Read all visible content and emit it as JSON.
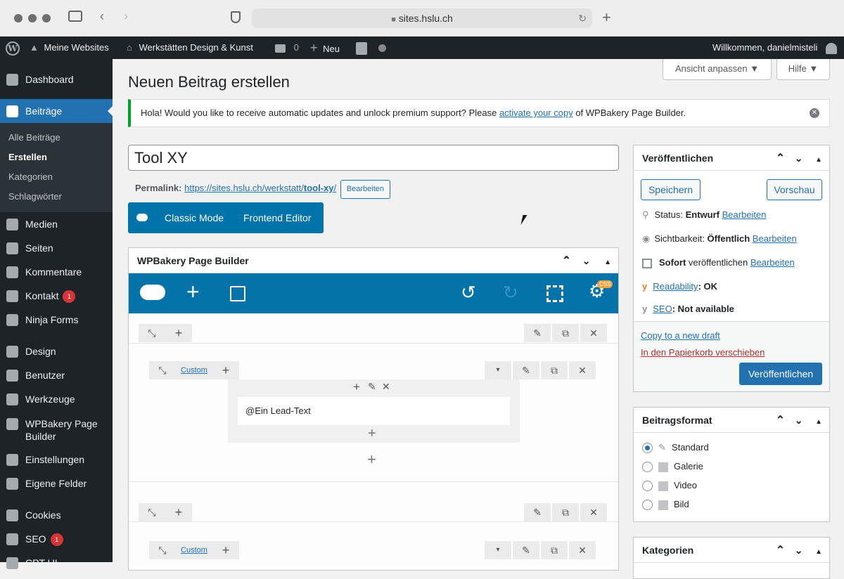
{
  "browser": {
    "url": "sites.hslu.ch"
  },
  "adminbar": {
    "my_sites": "Meine Websites",
    "site_name": "Werkstätten Design & Kunst",
    "comments_count": "0",
    "new_label": "Neu",
    "greeting": "Willkommen, danielmisteli"
  },
  "sidebar": {
    "items": [
      "Dashboard",
      "Beiträge",
      "Medien",
      "Seiten",
      "Kommentare",
      "Kontakt",
      "Ninja Forms",
      "Design",
      "Benutzer",
      "Werkzeuge",
      "WPBakery Page",
      "Builder",
      "Einstellungen",
      "Eigene Felder",
      "Cookies",
      "SEO",
      "CPT UI"
    ],
    "kontakt_badge": "1",
    "seo_badge": "1",
    "submenu": [
      "Alle Beiträge",
      "Erstellen",
      "Kategorien",
      "Schlagwörter"
    ]
  },
  "screen_options": "Ansicht anpassen",
  "help": "Hilfe",
  "page_title": "Neuen Beitrag erstellen",
  "notice": {
    "text_before": "Hola! Would you like to receive automatic updates and unlock premium support? Please ",
    "link": "activate your copy",
    "text_after": " of WPBakery Page Builder."
  },
  "post_title": "Tool XY",
  "permalink": {
    "label": "Permalink:",
    "url_base": "https://sites.hslu.ch/werkstatt/",
    "slug": "tool-xy",
    "slash": "/",
    "edit": "Bearbeiten"
  },
  "editor_modes": {
    "classic": "Classic Mode",
    "frontend": "Frontend Editor"
  },
  "wpbakery": {
    "title": "WPBakery Page Builder",
    "css_badge": "CSS",
    "custom_label": "Custom",
    "lead_text": "@Ein Lead-Text"
  },
  "publish": {
    "title": "Veröffentlichen",
    "save": "Speichern",
    "preview": "Vorschau",
    "status_label": "Status: ",
    "status_value": "Entwurf",
    "visibility_label": "Sichtbarkeit: ",
    "visibility_value": "Öffentlich",
    "schedule_strong": "Sofort",
    "schedule_rest": " veröffentlichen",
    "edit": "Bearbeiten",
    "readability": "Readability",
    "readability_value": ": OK",
    "seo": "SEO",
    "seo_value": ": Not available",
    "copy_draft": "Copy to a new draft",
    "trash": "In den Papierkorb verschieben",
    "publish_btn": "Veröffentlichen"
  },
  "format": {
    "title": "Beitragsformat",
    "options": [
      "Standard",
      "Galerie",
      "Video",
      "Bild"
    ],
    "selected": "Standard"
  },
  "categories": {
    "title": "Kategorien"
  }
}
